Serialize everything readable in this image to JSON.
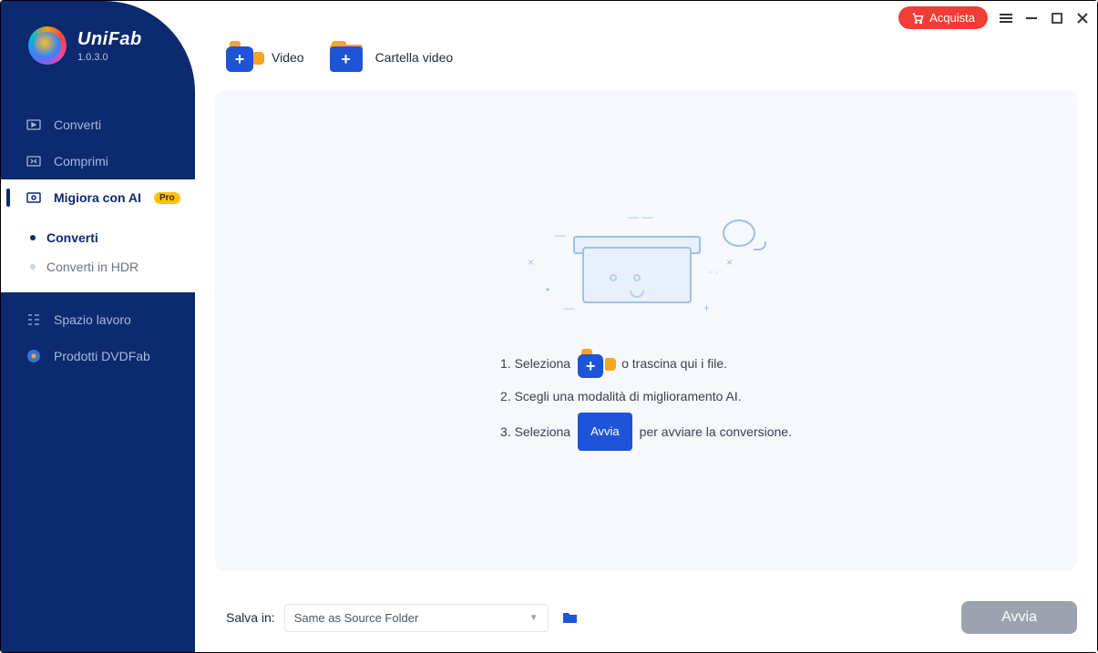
{
  "app": {
    "name": "UniFab",
    "version": "1.0.3.0"
  },
  "titlebar": {
    "buy": "Acquista"
  },
  "sidebar": {
    "items": [
      {
        "label": "Converti"
      },
      {
        "label": "Comprimi"
      },
      {
        "label": "Migiora con AI",
        "badge": "Pro"
      },
      {
        "label": "Spazio lavoro"
      },
      {
        "label": "Prodotti DVDFab"
      }
    ],
    "sub": [
      {
        "label": "Converti"
      },
      {
        "label": "Converti in HDR"
      }
    ]
  },
  "toolbar": {
    "video": "Video",
    "folder": "Cartella video"
  },
  "steps": {
    "s1a": "1. Seleziona",
    "s1b": "o trascina qui i file.",
    "s2": "2. Scegli una modalità di miglioramento AI.",
    "s3a": "3. Seleziona",
    "s3btn": "Avvia",
    "s3b": "per avviare la conversione."
  },
  "bottom": {
    "save_label": "Salva in:",
    "save_value": "Same as Source Folder",
    "start": "Avvia"
  }
}
